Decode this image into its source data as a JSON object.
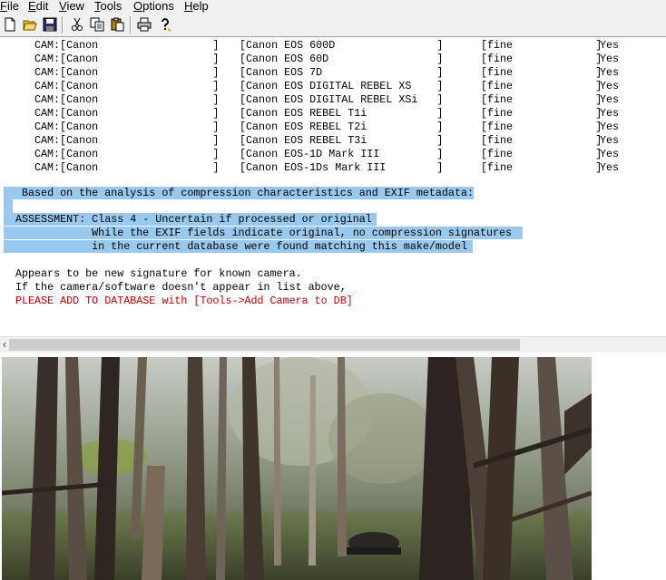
{
  "menu": [
    "File",
    "Edit",
    "View",
    "Tools",
    "Options",
    "Help"
  ],
  "toolbar": {
    "icons": [
      "new-icon",
      "open-icon",
      "save-icon",
      "cut-icon",
      "copy-icon",
      "paste-icon",
      "print-icon",
      "help-icon"
    ]
  },
  "cameras": [
    {
      "make": "CAM:[Canon                  ]",
      "model": "[Canon EOS 600D                ]",
      "quality": "[fine             ]",
      "match": "Yes"
    },
    {
      "make": "CAM:[Canon                  ]",
      "model": "[Canon EOS 60D                 ]",
      "quality": "[fine             ]",
      "match": "Yes"
    },
    {
      "make": "CAM:[Canon                  ]",
      "model": "[Canon EOS 7D                  ]",
      "quality": "[fine             ]",
      "match": "Yes"
    },
    {
      "make": "CAM:[Canon                  ]",
      "model": "[Canon EOS DIGITAL REBEL XS    ]",
      "quality": "[fine             ]",
      "match": "Yes"
    },
    {
      "make": "CAM:[Canon                  ]",
      "model": "[Canon EOS DIGITAL REBEL XSi   ]",
      "quality": "[fine             ]",
      "match": "Yes"
    },
    {
      "make": "CAM:[Canon                  ]",
      "model": "[Canon EOS REBEL T1i           ]",
      "quality": "[fine             ]",
      "match": "Yes"
    },
    {
      "make": "CAM:[Canon                  ]",
      "model": "[Canon EOS REBEL T2i           ]",
      "quality": "[fine             ]",
      "match": "Yes"
    },
    {
      "make": "CAM:[Canon                  ]",
      "model": "[Canon EOS REBEL T3i           ]",
      "quality": "[fine             ]",
      "match": "Yes"
    },
    {
      "make": "CAM:[Canon                  ]",
      "model": "[Canon EOS-1D Mark III         ]",
      "quality": "[fine             ]",
      "match": "Yes"
    },
    {
      "make": "CAM:[Canon                  ]",
      "model": "[Canon EOS-1Ds Mark III        ]",
      "quality": "[fine             ]",
      "match": "Yes"
    }
  ],
  "analysis": {
    "intro": "Based on the analysis of compression characteristics and EXIF metadata:",
    "assessment_1": "ASSESSMENT: Class 4 - Uncertain if processed or original",
    "assessment_2": "            While the EXIF fields indicate original, no compression signatures",
    "assessment_3": "            in the current database were found matching this make/model",
    "note_1": "Appears to be new signature for known camera.",
    "note_2": "If the camera/software doesn't appear in list above,",
    "note_3": "PLEASE ADD TO DATABASE with [Tools->Add Camera to DB]"
  },
  "colors": {
    "highlight": "#99c9ef",
    "warning": "#c00000"
  }
}
